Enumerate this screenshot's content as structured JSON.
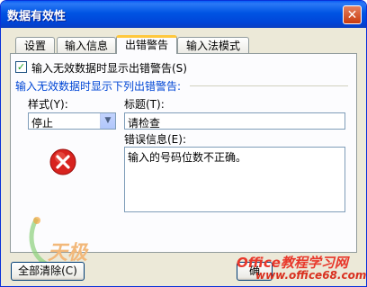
{
  "dialog": {
    "title": "数据有效性",
    "close_glyph": "✕"
  },
  "tabs": [
    {
      "label": "设置"
    },
    {
      "label": "输入信息"
    },
    {
      "label": "出错警告"
    },
    {
      "label": "输入法模式"
    }
  ],
  "error_alert": {
    "checkbox_label": "输入无效数据时显示出错警告(S)",
    "checkbox_checked": true,
    "group_label": "输入无效数据时显示下列出错警告:",
    "style_label": "样式(Y):",
    "style_value": "停止",
    "title_label": "标题(T):",
    "title_value": "请检查",
    "message_label": "错误信息(E):",
    "message_value": "输入的号码位数不正确。"
  },
  "buttons": {
    "clear_all": "全部清除(C)",
    "ok_partial": "确"
  },
  "watermark": {
    "logo_text": "天极",
    "office_text": "Office教程学习网",
    "url_text": "www.office68.com"
  }
}
